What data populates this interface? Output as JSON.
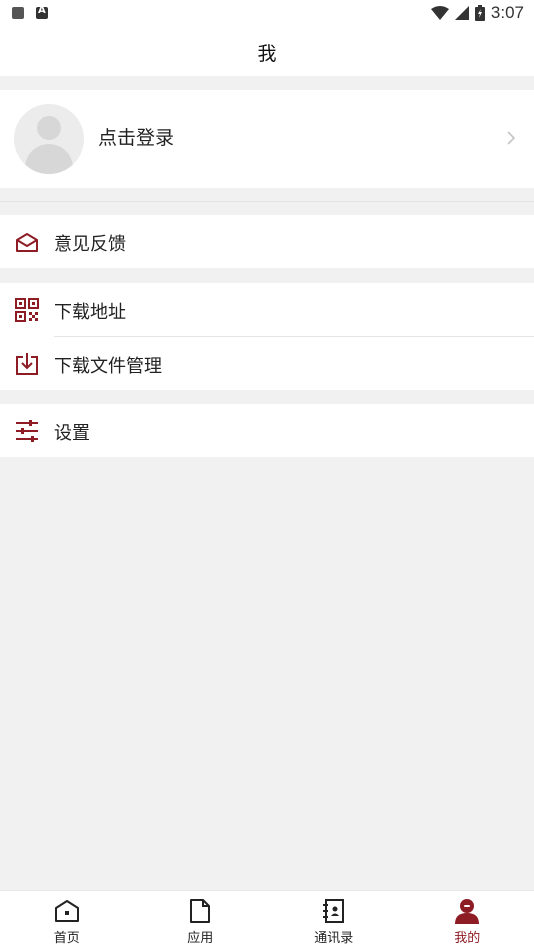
{
  "status_bar": {
    "time": "3:07",
    "left_icons": [
      "notification-icon",
      "a-badge-icon"
    ],
    "right_icons": [
      "wifi-icon",
      "signal-icon",
      "battery-icon"
    ]
  },
  "header": {
    "title": "我"
  },
  "profile": {
    "login_label": "点击登录"
  },
  "menu": {
    "feedback": "意见反馈",
    "download_address": "下载地址",
    "download_file_manage": "下载文件管理",
    "settings": "设置"
  },
  "tabbar": {
    "items": [
      {
        "label": "首页",
        "icon": "home-icon",
        "active": false
      },
      {
        "label": "应用",
        "icon": "document-icon",
        "active": false
      },
      {
        "label": "通讯录",
        "icon": "contacts-icon",
        "active": false
      },
      {
        "label": "我的",
        "icon": "profile-icon",
        "active": true
      }
    ]
  },
  "colors": {
    "accent": "#8e1c25",
    "background": "#f1f1f1",
    "surface": "#ffffff",
    "text": "#222222"
  }
}
